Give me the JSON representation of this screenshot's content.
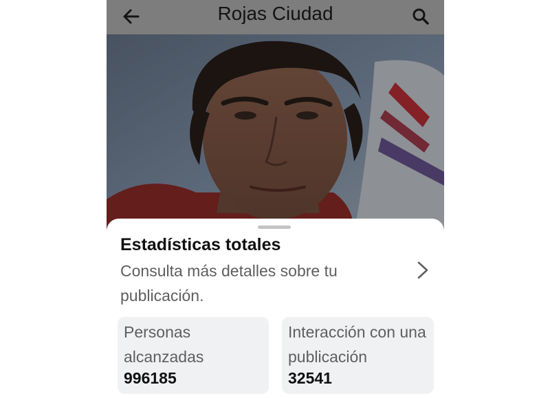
{
  "header": {
    "title": "Rojas Ciudad",
    "back_icon": "arrow-left-icon",
    "search_icon": "search-icon"
  },
  "post_image": {
    "description": "portrait-photo"
  },
  "sheet": {
    "title": "Estadísticas totales",
    "subtitle": "Consulta más detalles sobre tu publicación.",
    "chevron_icon": "chevron-right-icon"
  },
  "stats": [
    {
      "label": "Personas alcanzadas",
      "value": "996185"
    },
    {
      "label": "Interacción con una publicación",
      "value": "32541"
    }
  ],
  "colors": {
    "topbar": "#7d7d7d",
    "card": "#f0f1f3",
    "secondary_text": "#5e5e5e"
  }
}
